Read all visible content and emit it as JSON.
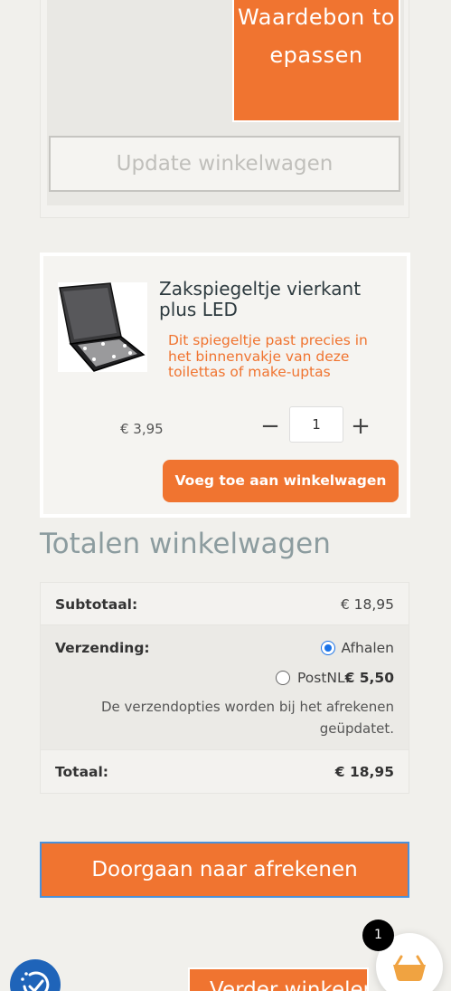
{
  "coupon": {
    "apply_label": "Waardebon toepassen"
  },
  "cart": {
    "update_label": "Update winkelwagen"
  },
  "upsell": {
    "title": "Zakspiegeltje vierkant plus LED",
    "description": "Dit spiegeltje past precies in het binnenvakje van deze toilettas of make-uptas",
    "price": "€ 3,95",
    "quantity": "1",
    "minus_symbol": "−",
    "plus_symbol": "+",
    "add_label": "Voeg toe aan winkelwagen",
    "image_icon": "pocket-mirror-led-product-image"
  },
  "totals": {
    "heading": "Totalen winkelwagen",
    "subtotal_label": "Subtotaal:",
    "subtotal_value": "€ 18,95",
    "shipping_label": "Verzending:",
    "shipping_options": [
      {
        "label": "Afhalen",
        "price": "",
        "selected": true
      },
      {
        "label": "PostNL:",
        "price": "€ 5,50",
        "selected": false
      }
    ],
    "shipping_note": "De verzendopties worden bij het afrekenen geüpdatet.",
    "total_label": "Totaal:",
    "total_value": "€ 18,95"
  },
  "checkout": {
    "proceed_label": "Doorgaan naar afrekenen",
    "continue_label": "Verder winkelen"
  },
  "floating_cart": {
    "count": "1",
    "icon": "basket-icon"
  },
  "accessibility": {
    "icon": "accessibility-icon"
  },
  "colors": {
    "accent": "#f07430",
    "heading_muted": "#8c9c9f",
    "accessibility_blue": "#1f64b9",
    "radio_blue": "#1a73e8"
  }
}
